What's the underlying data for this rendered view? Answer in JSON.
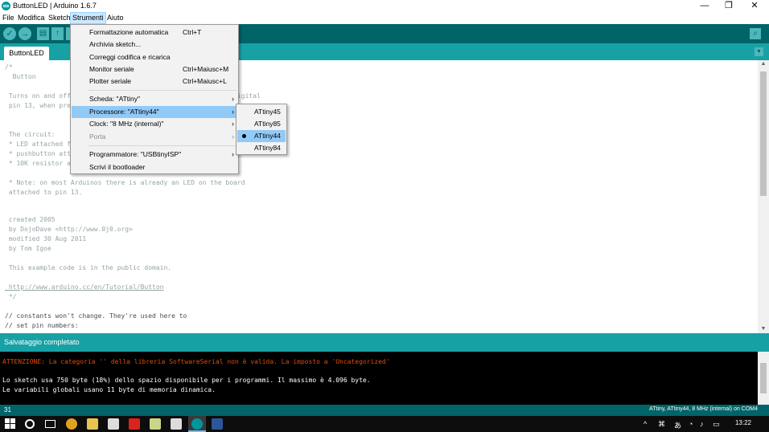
{
  "window": {
    "title": "ButtonLED | Arduino 1.6.7",
    "minimize": "—",
    "maximize": "❐",
    "close": "✕"
  },
  "menubar": [
    "File",
    "Modifica",
    "Sketch",
    "Strumenti",
    "Aiuto"
  ],
  "toolbar": {
    "verify": "✓",
    "upload": "→",
    "new": "▤",
    "open": "↑",
    "save": "↓",
    "serial": "⌕"
  },
  "tabs": {
    "active": "ButtonLED",
    "menu": "▼"
  },
  "editor": {
    "lines": [
      "/*",
      "  Button",
      "",
      " Turns on and off a light emitting diode(LED) connected to digital",
      " pin 13, when pressing a pushbutton attached to pin 2.",
      "",
      "",
      " The circuit:",
      " * LED attached from pin 13 to ground",
      " * pushbutton attached to pin 2 from +5V",
      " * 10K resistor attached to pin 2 from ground",
      "",
      " * Note: on most Arduinos there is already an LED on the board",
      " attached to pin 13.",
      "",
      "",
      " created 2005",
      " by DojoDave <http://www.0j0.org>",
      " modified 30 Aug 2011",
      " by Tom Igoe",
      "",
      " This example code is in the public domain.",
      "",
      " http://www.arduino.cc/en/Tutorial/Button",
      " */",
      "",
      "// constants won't change. They're used here to",
      "// set pin numbers:"
    ]
  },
  "status": {
    "message": "Salvataggio completato"
  },
  "console": {
    "lines": [
      "ATTENZIONE: La categoria '' della libreria SoftwareSerial non è valida. La imposto a 'Uncategorized'",
      "",
      "Lo sketch usa 750 byte (18%) dello spazio disponibile per i programmi. Il massimo è 4.096 byte.",
      "Le variabili globali usano 11 byte di memoria dinamica."
    ]
  },
  "bottom": {
    "line": "31",
    "board": "ATtiny, ATtiny44, 8 MHz (internal) on COM4"
  },
  "strumenti_menu": {
    "items": [
      {
        "label": "Formattazione automatica",
        "shortcut": "Ctrl+T"
      },
      {
        "label": "Archivia sketch...",
        "shortcut": ""
      },
      {
        "label": "Correggi codifica e ricarica",
        "shortcut": ""
      },
      {
        "label": "Monitor seriale",
        "shortcut": "Ctrl+Maiusc+M"
      },
      {
        "label": "Plotter seriale",
        "shortcut": "Ctrl+Maiusc+L"
      },
      {
        "label": "Scheda: \"ATtiny\"",
        "shortcut": ""
      },
      {
        "label": "Processore: \"ATtiny44\"",
        "shortcut": ""
      },
      {
        "label": "Clock: \"8 MHz (internal)\"",
        "shortcut": ""
      },
      {
        "label": "Porta",
        "shortcut": ""
      },
      {
        "label": "Programmatore: \"USBtinyISP\"",
        "shortcut": ""
      },
      {
        "label": "Scrivi il bootloader",
        "shortcut": ""
      }
    ],
    "submenu_arrow": "›"
  },
  "processore_submenu": {
    "items": [
      "ATtiny45",
      "ATtiny85",
      "ATtiny44",
      "ATtiny84"
    ],
    "selected": "ATtiny44"
  },
  "taskbar": {
    "clock": "13:22"
  },
  "colors": {
    "accent_dark": "#006468",
    "accent": "#17a1a5",
    "highlight": "#91c9f7",
    "error": "#e34c00"
  }
}
